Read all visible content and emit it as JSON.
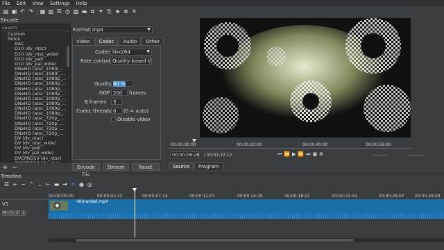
{
  "menu": [
    "File",
    "Edit",
    "View",
    "Settings",
    "Help"
  ],
  "encode": {
    "title": "Encode",
    "search_placeholder": "search",
    "presets": [
      {
        "label": "Custom",
        "level": "group"
      },
      {
        "label": "Stock",
        "level": "group-sel"
      },
      {
        "label": "AAC",
        "level": "item"
      },
      {
        "label": "D10 (dv_ntsc)",
        "level": "item"
      },
      {
        "label": "D10 (dv_ntsc_wide)",
        "level": "item"
      },
      {
        "label": "D10 (dv_pal)",
        "level": "item"
      },
      {
        "label": "D10 (dv_pal_wide)",
        "level": "item"
      },
      {
        "label": "DNxHD (atsc_1080i_...",
        "level": "item"
      },
      {
        "label": "DNxHD (atsc_1080i_...",
        "level": "item"
      },
      {
        "label": "DNxHD (atsc_1080p_...",
        "level": "item"
      },
      {
        "label": "DNxHD (atsc_1080p_...",
        "level": "item"
      },
      {
        "label": "DNxHD (atsc_1080p_...",
        "level": "item"
      },
      {
        "label": "DNxHD (atsc_1080p_...",
        "level": "item"
      },
      {
        "label": "DNxHD (atsc_1080p_...",
        "level": "item"
      },
      {
        "label": "DNxHD (atsc_1080p_...",
        "level": "item"
      },
      {
        "label": "DNxHD (atsc_1080p_...",
        "level": "item"
      },
      {
        "label": "DNxHD (atsc_1080p_...",
        "level": "item"
      },
      {
        "label": "DNxHD (atsc_720p_...",
        "level": "item"
      },
      {
        "label": "DNxHD (atsc_720p_...",
        "level": "item"
      },
      {
        "label": "DNxHD (atsc_720p_...",
        "level": "item"
      },
      {
        "label": "DNxHD (atsc_720p_...",
        "level": "item"
      },
      {
        "label": "DV (dv_ntsc)",
        "level": "item"
      },
      {
        "label": "DV (dv_ntsc_wide)",
        "level": "item"
      },
      {
        "label": "DV (dv_pal)",
        "level": "item"
      },
      {
        "label": "DV (dv_pal_wide)",
        "level": "item"
      },
      {
        "label": "DVCPRO50 (dv_ntsc)",
        "level": "item"
      },
      {
        "label": "DVCPRO50 (dv_ntsc...",
        "level": "item"
      }
    ],
    "add_label": "+",
    "remove_label": "−",
    "format_label": "Format",
    "format_value": "mp4",
    "tabs": [
      "Video",
      "Codec",
      "Audio",
      "Other"
    ],
    "codec_label": "Codec",
    "codec_value": "libx264",
    "rate_control_label": "Rate control",
    "rate_control_value": "Quality-based V",
    "quality_label": "Quality",
    "quality_value": "60 %",
    "gop_label": "GOP",
    "gop_value": "200",
    "gop_unit": "frames",
    "bframes_label": "B frames",
    "bframes_value": "3",
    "threads_label": "Codec threads",
    "threads_value": "0",
    "threads_hint": "(0 = auto)",
    "disable_video_label": "Disable video",
    "encode_file_label": "Encode File",
    "stream_label": "Stream",
    "reset_label": "Reset"
  },
  "player": {
    "ruler": [
      "00:00:00:00",
      "00:00:20:00",
      "00:00:40:00",
      "00:00:59:30"
    ],
    "position": "00:00:06:28",
    "duration": "/ 00:01:22:12",
    "in_point": "--:--:--:--",
    "out_point": "--:--:--:--",
    "tabs": [
      "Source",
      "Program"
    ]
  },
  "timeline": {
    "title": "Timeline",
    "ruler": [
      "00:00:00:00",
      "00:00:03:22",
      "00:00:07:14",
      "00:00:11:07",
      "00:00:14:29",
      "00:00:18:22",
      "00:00:22:14",
      "00:00:26:07",
      "00:00:29:29"
    ],
    "track_name": "V1",
    "track_buttons": [
      "M",
      "H",
      "C",
      "L"
    ],
    "clip_name": "4Kmandel.mp4"
  }
}
